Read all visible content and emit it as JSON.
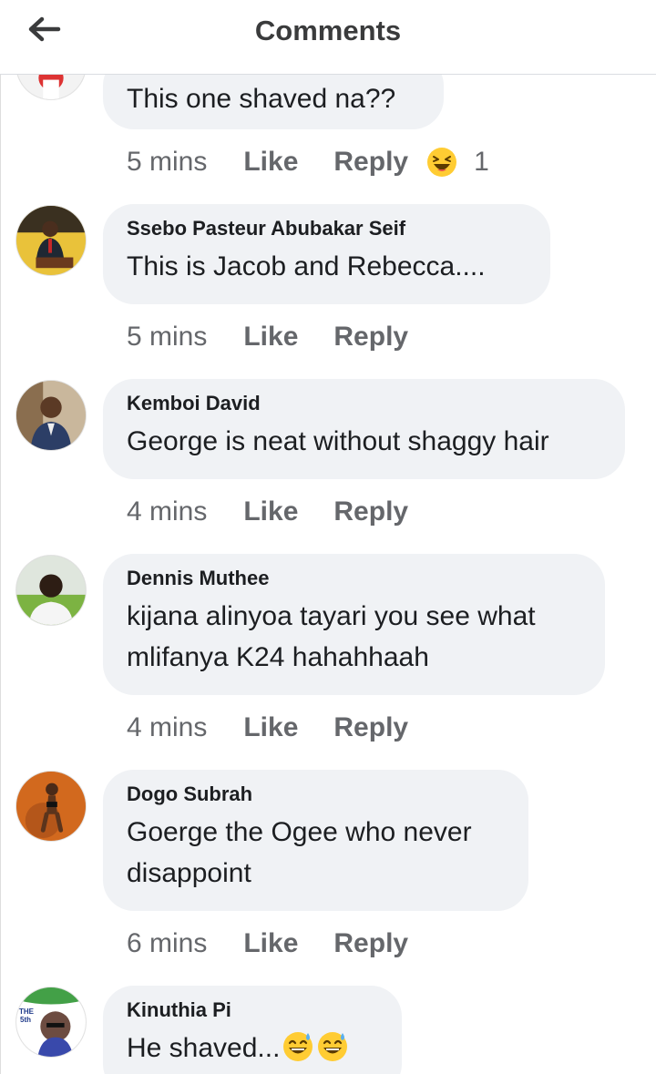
{
  "header": {
    "title": "Comments"
  },
  "comments": [
    {
      "author": "",
      "text": "This one shaved na??",
      "time": "5 mins",
      "like": "Like",
      "reply": "Reply",
      "reaction_count": "1",
      "reaction_icon": "laughing-emoji-icon"
    },
    {
      "author": "Ssebo Pasteur Abubakar Seif",
      "text": "This is Jacob and Rebecca....",
      "time": "5 mins",
      "like": "Like",
      "reply": "Reply"
    },
    {
      "author": "Kemboi David",
      "text": "George is neat without shaggy hair",
      "time": "4 mins",
      "like": "Like",
      "reply": "Reply"
    },
    {
      "author": "Dennis Muthee",
      "text_lines": [
        "kijana alinyoa tayari you see what",
        "mlifanya K24 hahahhaah"
      ],
      "time": "4 mins",
      "like": "Like",
      "reply": "Reply"
    },
    {
      "author": "Dogo Subrah",
      "text_lines": [
        "Goerge the Ogee who never",
        "disappoint"
      ],
      "time": "6 mins",
      "like": "Like",
      "reply": "Reply"
    },
    {
      "author": "Kinuthia Pi",
      "text": "He shaved...",
      "text_emojis": [
        "sweat-smile-emoji-icon",
        "sweat-smile-emoji-icon"
      ]
    }
  ],
  "avatar_badge": "THE 5th",
  "colors": {
    "bubble": "#f0f2f5",
    "meta_text": "#65676b",
    "text": "#1c1e21",
    "emoji_yellow": "#ffcc33"
  }
}
